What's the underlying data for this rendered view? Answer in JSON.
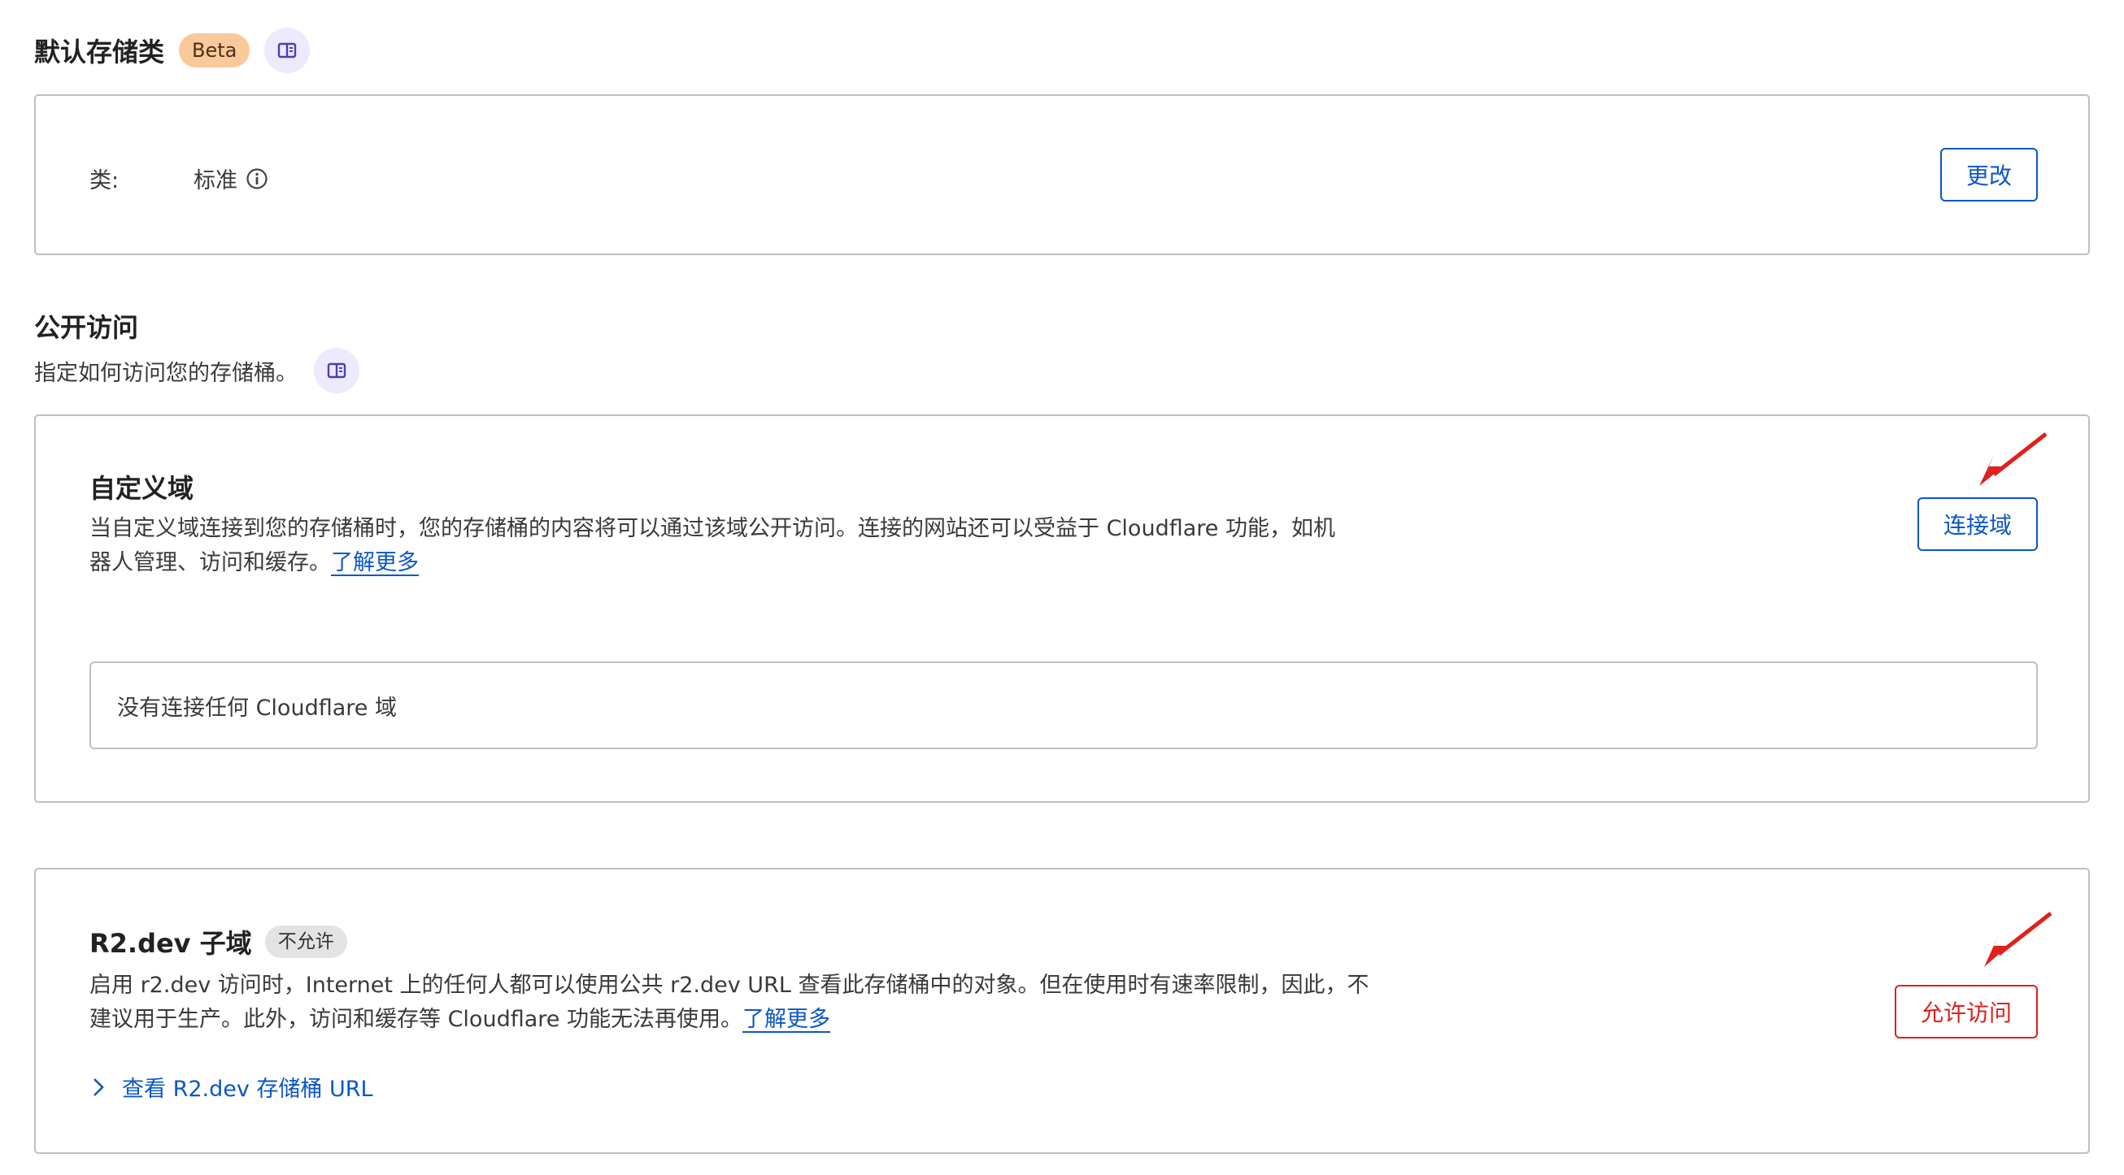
{
  "storage_class": {
    "title": "默认存储类",
    "badge": "Beta",
    "label": "类:",
    "value": "标准",
    "change_button": "更改"
  },
  "public_access": {
    "title": "公开访问",
    "subtitle": "指定如何访问您的存储桶。"
  },
  "custom_domain": {
    "title": "自定义域",
    "description_line1": "当自定义域连接到您的存储桶时，您的存储桶的内容将可以通过该域公开访问。连接的网站还可以受益于 Cloudflare 功能，如机",
    "description_line2": "器人管理、访问和缓存。",
    "learn_more": "了解更多",
    "connect_button": "连接域",
    "empty_state": "没有连接任何 Cloudflare 域"
  },
  "r2_dev": {
    "title": "R2.dev 子域",
    "status_badge": "不允许",
    "description_line1": "启用 r2.dev 访问时，Internet 上的任何人都可以使用公共 r2.dev URL 查看此存储桶中的对象。但在使用时有速率限制，因此，不",
    "description_line2": "建议用于生产。此外，访问和缓存等 Cloudflare 功能无法再使用。",
    "learn_more": "了解更多",
    "allow_button": "允许访问",
    "view_url": "查看 R2.dev 存储桶 URL"
  },
  "colors": {
    "accent_blue": "#0b57c7",
    "annotation_red": "#e0201b",
    "beta_badge": "#f9c99a"
  },
  "icons": [
    "book-icon",
    "info-icon",
    "chevron-right-icon",
    "red-arrow-annotation"
  ]
}
